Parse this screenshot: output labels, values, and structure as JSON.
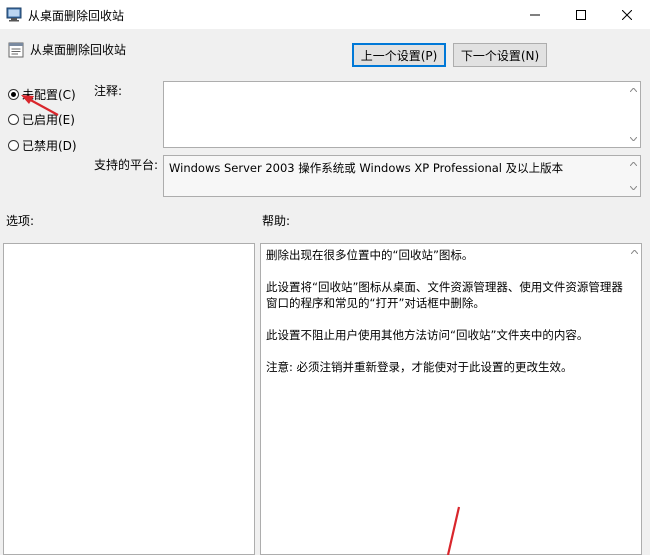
{
  "window": {
    "title": "从桌面删除回收站",
    "minimize_icon": "minimize-icon",
    "maximize_icon": "maximize-icon",
    "close_icon": "close-icon"
  },
  "header": {
    "title": "从桌面删除回收站",
    "icon": "policy-icon"
  },
  "nav": {
    "prev_label": "上一个设置(P)",
    "next_label": "下一个设置(N)"
  },
  "state": {
    "options": [
      {
        "label": "未配置(C)",
        "selected": true
      },
      {
        "label": "已启用(E)",
        "selected": false
      },
      {
        "label": "已禁用(D)",
        "selected": false
      }
    ]
  },
  "comment": {
    "label": "注释:",
    "value": ""
  },
  "platform": {
    "label": "支持的平台:",
    "value": "Windows Server 2003 操作系统或 Windows XP Professional 及以上版本"
  },
  "options_section": {
    "label": "选项:"
  },
  "help_section": {
    "label": "帮助:",
    "paragraphs": [
      "删除出现在很多位置中的“回收站”图标。",
      "此设置将“回收站”图标从桌面、文件资源管理器、使用文件资源管理器窗口的程序和常见的“打开”对话框中删除。",
      "此设置不阻止用户使用其他方法访问“回收站”文件夹中的内容。",
      "注意: 必须注销并重新登录，才能使对于此设置的更改生效。"
    ]
  },
  "colors": {
    "accent": "#0078d7",
    "annotation_arrow": "#d9262c"
  }
}
